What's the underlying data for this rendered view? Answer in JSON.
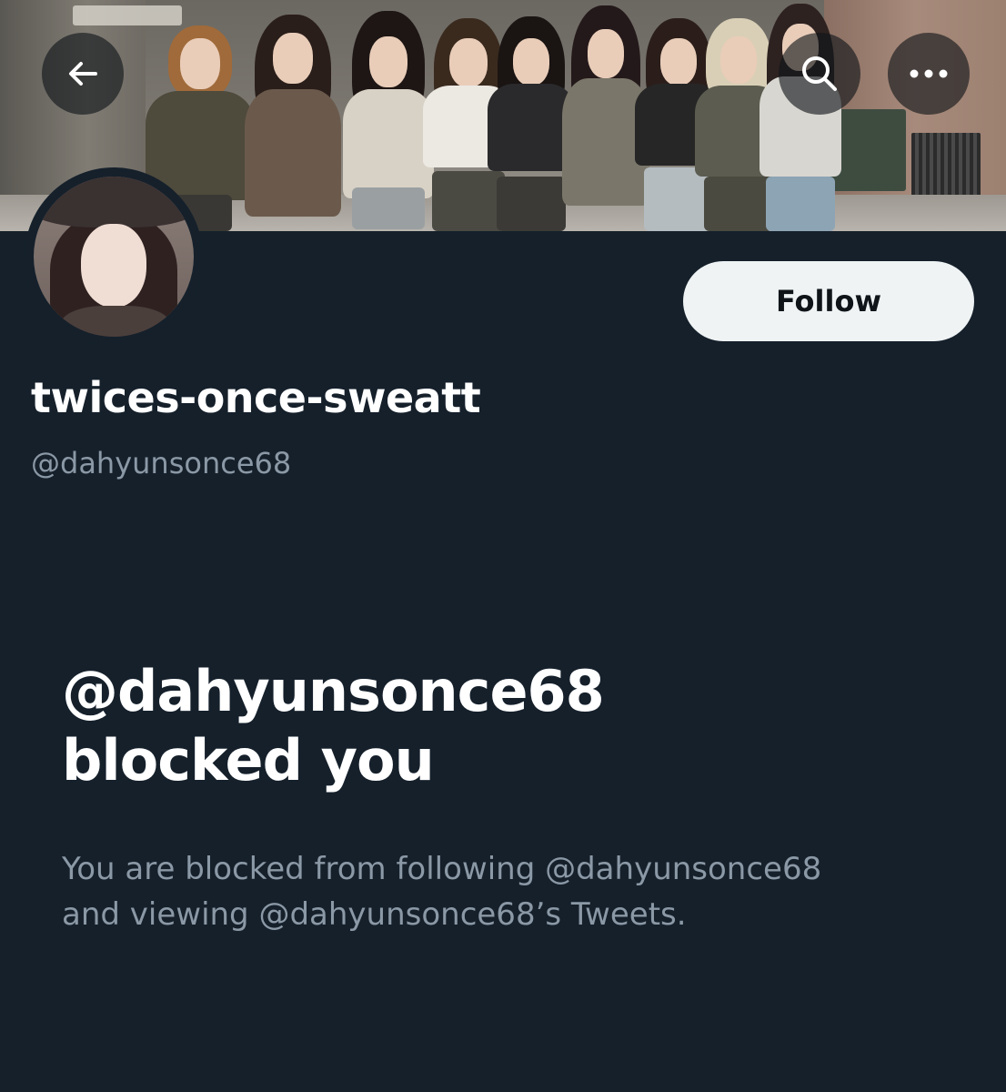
{
  "header": {
    "back_icon": "arrow-left-icon",
    "search_icon": "search-icon",
    "more_icon": "more-horizontal-icon",
    "banner_image": "group-photo-banner"
  },
  "profile": {
    "avatar_image": "profile-avatar-photo",
    "display_name": "twices-once-sweatt",
    "handle": "@dahyunsonce68",
    "follow_label": "Follow"
  },
  "blocked": {
    "title_line1": "@dahyunsonce68",
    "title_line2": "blocked you",
    "desc_line1": "You are blocked from following @dahyunsonce68",
    "desc_line2": "and viewing @dahyunsonce68’s Tweets."
  },
  "colors": {
    "background": "#15202b",
    "primary_text": "#ffffff",
    "secondary_text": "#8b98a5",
    "follow_button_bg": "#eff3f4",
    "follow_button_text": "#0f1419"
  }
}
